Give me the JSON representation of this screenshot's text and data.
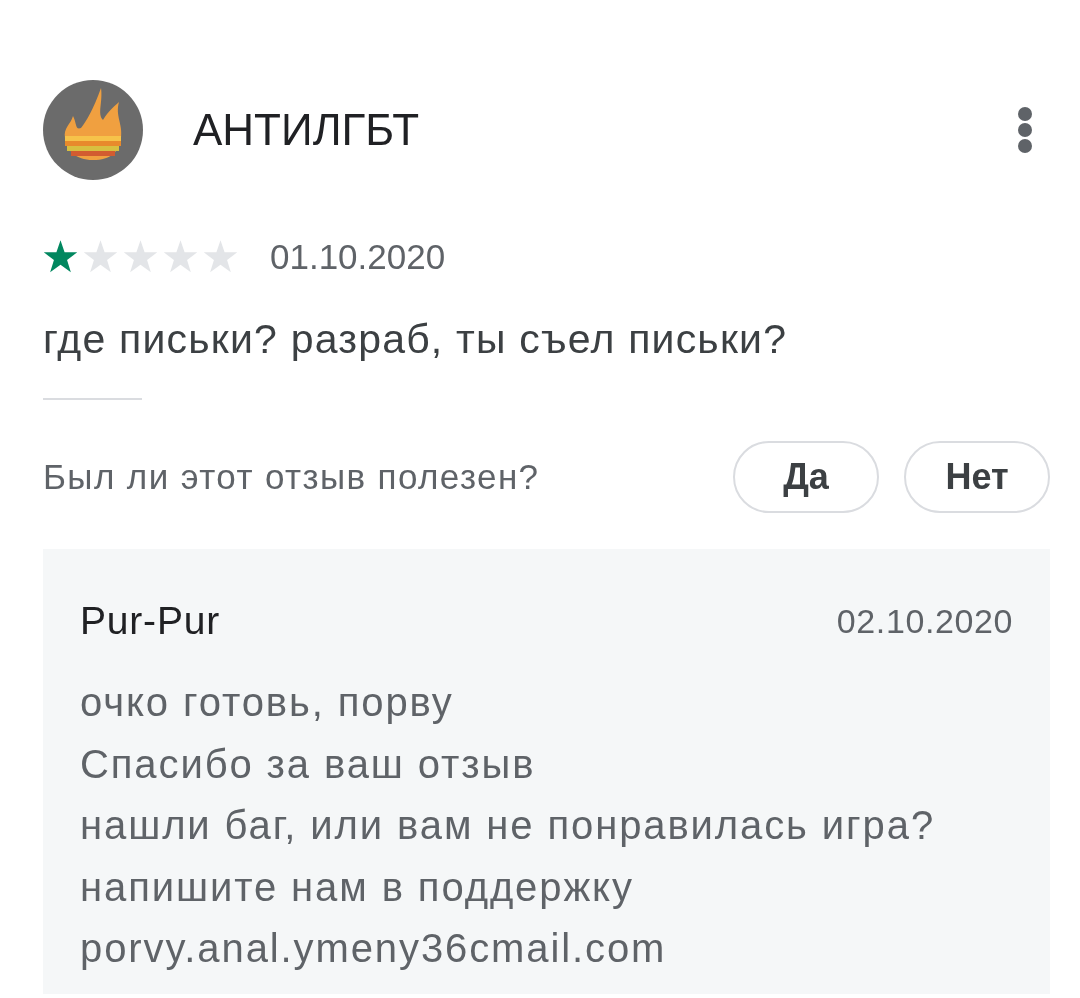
{
  "review": {
    "author": "АНТИЛГБТ",
    "stars": 1,
    "date": "01.10.2020",
    "text": "где письки? разраб, ты съел письки?"
  },
  "helpful": {
    "question": "Был ли этот отзыв полезен?",
    "buttons": [
      {
        "label": "Да",
        "selected": false
      },
      {
        "label": "Нет",
        "selected": false
      }
    ]
  },
  "reply": {
    "author": "Pur-Pur",
    "date": "02.10.2020",
    "text": "очко готовь, порву\nСпасибо за ваш отзыв\nнашли баг, или вам не понравилась игра?\nнапишите нам в поддержку\nporvy.anal.ymeny36cmail.com"
  }
}
